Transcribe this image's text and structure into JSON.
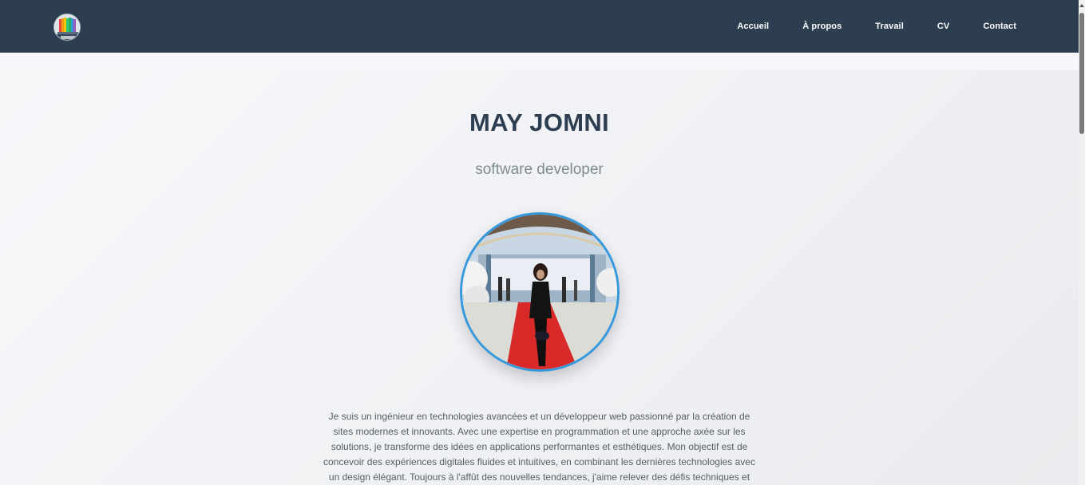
{
  "nav": {
    "logo_icon": "colorful-books-logo-icon",
    "links": [
      "Accueil",
      "À propos",
      "Travail",
      "CV",
      "Contact"
    ]
  },
  "hero": {
    "name": "MAY JOMNI",
    "role": "software developer",
    "photo_icon": "profile-photo",
    "bio": "Je suis un ingénieur en technologies avancées et un développeur web passionné par la création de sites modernes et innovants. Avec une expertise en programmation et une approche axée sur les solutions, je transforme des idées en applications performantes et esthétiques. Mon objectif est de concevoir des expériences digitales fluides et intuitives, en combinant les dernières technologies avec un design élégant. Toujours à l'affût des nouvelles tendances, j'aime relever des défis techniques et"
  },
  "colors": {
    "navbar": "#2c3e50",
    "accent": "#3498db",
    "title": "#2c3e50",
    "subtitle": "#7f8c8d"
  }
}
